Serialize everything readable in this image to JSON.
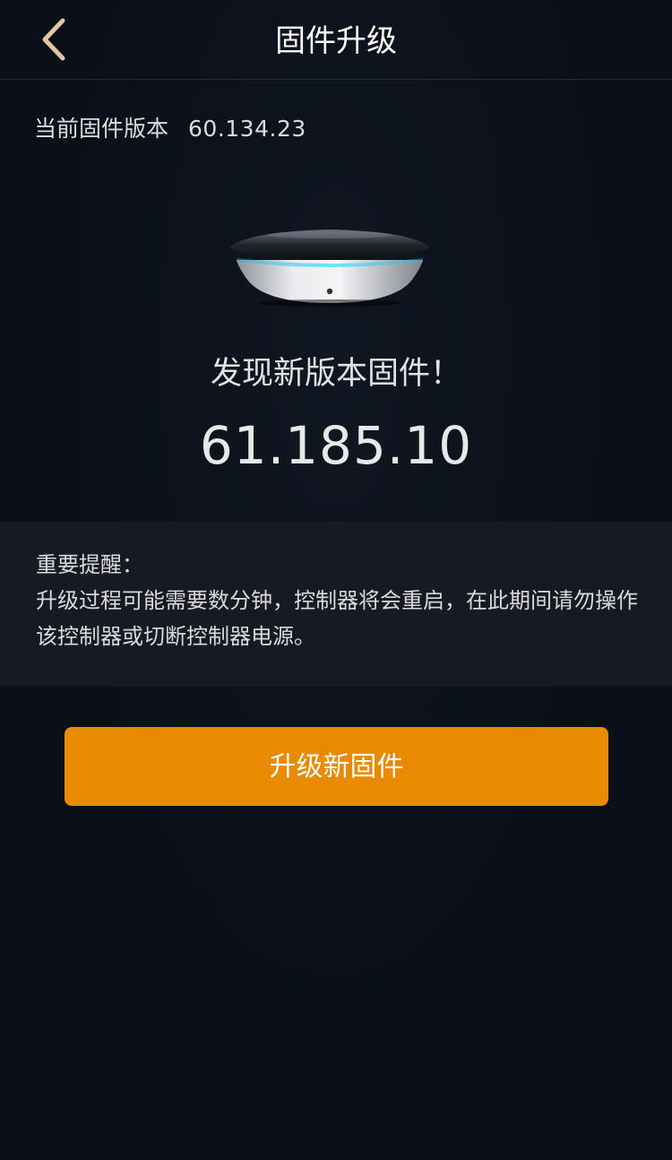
{
  "navbar": {
    "title": "固件升级",
    "back_icon": "chevron-left-icon"
  },
  "current": {
    "label": "当前固件版本",
    "version": "60.134.23"
  },
  "device": {
    "image": "smart-controller-device"
  },
  "update": {
    "found_text": "发现新版本固件！",
    "new_version": "61.185.10"
  },
  "notice": {
    "title": "重要提醒：",
    "body": "升级过程可能需要数分钟，控制器将会重启，在此期间请勿操作该控制器或切断控制器电源。"
  },
  "actions": {
    "upgrade_label": "升级新固件"
  },
  "colors": {
    "background": "#0a0f18",
    "panel": "#151a23",
    "accent": "#e98a00",
    "back_icon": "#e3c6a6"
  }
}
